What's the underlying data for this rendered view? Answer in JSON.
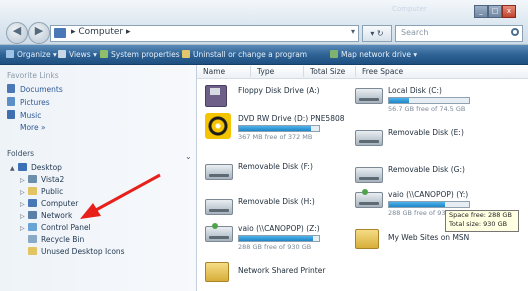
{
  "window": {
    "caption_text": "Computer",
    "min_label": "_",
    "max_label": "□",
    "close_label": "x"
  },
  "address": {
    "text": "▸ Computer ▸",
    "dropdown": "▾"
  },
  "refresh": {
    "label": "▾ ↻"
  },
  "search": {
    "placeholder": "Search"
  },
  "toolbar": {
    "items": [
      "Organize ▾",
      "Views ▾",
      "System properties",
      "Uninstall or change a program",
      "Map network drive ▾"
    ]
  },
  "nav": {
    "favorites_header": "Favorite Links",
    "favorites": [
      "Documents",
      "Pictures",
      "Music",
      "More »"
    ],
    "folders_header": "Folders",
    "folders": [
      "Desktop",
      "Vista2",
      "Public",
      "Computer",
      "Network",
      "Control Panel",
      "Recycle Bin",
      "Unused Desktop Icons"
    ]
  },
  "columns": [
    "Name",
    "Type",
    "Total Size",
    "Free Space"
  ],
  "drives": [
    {
      "name": "Floppy Disk Drive (A:)",
      "free": "",
      "level": null
    },
    {
      "name": "DVD RW Drive (D:) PNE5808",
      "free": "367 MB free of 372 MB",
      "level": 0.9
    },
    {
      "name": "Removable Disk (F:)",
      "free": "",
      "level": null
    },
    {
      "name": "Removable Disk (H:)",
      "free": "",
      "level": null
    },
    {
      "name": "vaio (\\\\CANOPOP) (Z:)",
      "free": "288 GB free of 930 GB",
      "level": 0.92
    },
    {
      "name": "Network Shared Printer",
      "free": "",
      "level": null
    },
    {
      "name": "Local Disk (C:)",
      "free": "56.7 GB free of 74.5 GB",
      "level": 0.25
    },
    {
      "name": "Removable Disk (E:)",
      "free": "",
      "level": null
    },
    {
      "name": "Removable Disk (G:)",
      "free": "",
      "level": null
    },
    {
      "name": "vaio (\\\\CANOPOP) (Y:)",
      "free": "288 GB free of 930 GB",
      "level": 0.7
    },
    {
      "name": "My Web Sites on MSN",
      "free": "",
      "level": null
    }
  ],
  "tooltip": {
    "line1": "Space free: 288 GB",
    "line2": "Total size: 930 GB"
  },
  "colors": {
    "toolbar": "#2f6396",
    "arrow": "#e8201a",
    "bar_fill": "#1e86c8"
  }
}
